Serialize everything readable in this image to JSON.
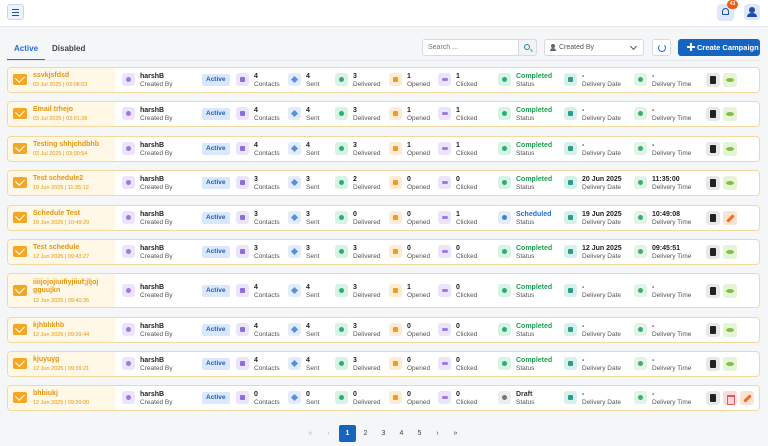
{
  "header": {
    "menu_icon": "menu-icon",
    "notification_icon": "bell-icon",
    "notification_count": "43",
    "user_icon": "user-icon"
  },
  "tabs": [
    {
      "label": "Active",
      "active": true
    },
    {
      "label": "Disabled",
      "active": false
    }
  ],
  "toolbar": {
    "search_placeholder": "Search ...",
    "filter_label": "Created By",
    "create_label": "Create Campaign"
  },
  "labels": {
    "created_by": "Created By",
    "contacts": "Contacts",
    "sent": "Sent",
    "delivered": "Delivered",
    "opened": "Opened",
    "clicked": "Clicked",
    "status": "Status",
    "delivery_date": "Delivery Date",
    "delivery_time": "Delivery Time"
  },
  "campaigns": [
    {
      "name": "ssvkjsfdsd",
      "date": "03 Jul 2025",
      "time": "03:08:03",
      "creator": "harshB",
      "state": "Active",
      "contacts": "4",
      "sent": "4",
      "delivered": "3",
      "opened": "1",
      "clicked": "1",
      "status": "Completed",
      "status_kind": "completed",
      "delivery_date": "-",
      "delivery_time": "-",
      "actions": [
        "copy",
        "view"
      ]
    },
    {
      "name": "Email trhejo",
      "date": "03 Jul 2025",
      "time": "03:01:28",
      "creator": "harshB",
      "state": "Active",
      "contacts": "4",
      "sent": "4",
      "delivered": "3",
      "opened": "1",
      "clicked": "1",
      "status": "Completed",
      "status_kind": "completed",
      "delivery_date": "-",
      "delivery_time": "-",
      "actions": [
        "copy",
        "view"
      ]
    },
    {
      "name": "Testing shhjchdbhb",
      "date": "03 Jul 2025",
      "time": "03:00:54",
      "creator": "harshB",
      "state": "Active",
      "contacts": "4",
      "sent": "4",
      "delivered": "3",
      "opened": "1",
      "clicked": "1",
      "status": "Completed",
      "status_kind": "completed",
      "delivery_date": "-",
      "delivery_time": "-",
      "actions": [
        "copy",
        "view"
      ]
    },
    {
      "name": "Test schedule2",
      "date": "19 Jun 2025",
      "time": "11:35:12",
      "creator": "harshB",
      "state": "Active",
      "contacts": "3",
      "sent": "3",
      "delivered": "2",
      "opened": "0",
      "clicked": "0",
      "status": "Completed",
      "status_kind": "completed",
      "delivery_date": "20 Jun 2025",
      "delivery_time": "11:35:00",
      "actions": [
        "copy",
        "view"
      ]
    },
    {
      "name": "Schedule Test",
      "date": "19 Jun 2025",
      "time": "10:49:29",
      "creator": "harshB",
      "state": "Active",
      "contacts": "3",
      "sent": "3",
      "delivered": "0",
      "opened": "0",
      "clicked": "1",
      "status": "Scheduled",
      "status_kind": "scheduled",
      "delivery_date": "19 Jun 2025",
      "delivery_time": "10:49:08",
      "actions": [
        "copy",
        "edit"
      ]
    },
    {
      "name": "Test schedule",
      "date": "12 Jun 2025",
      "time": "09:43:27",
      "creator": "harshB",
      "state": "Active",
      "contacts": "3",
      "sent": "3",
      "delivered": "3",
      "opened": "0",
      "clicked": "0",
      "status": "Completed",
      "status_kind": "completed",
      "delivery_date": "12 Jun 2025",
      "delivery_time": "09:45:51",
      "actions": [
        "copy",
        "view"
      ]
    },
    {
      "name": "iiiijojojiuifiyjiiuf;jljoj gguujkn",
      "date": "12 Jun 2025",
      "time": "09:40:35",
      "creator": "harshB",
      "state": "Active",
      "contacts": "4",
      "sent": "4",
      "delivered": "3",
      "opened": "1",
      "clicked": "0",
      "status": "Completed",
      "status_kind": "completed",
      "delivery_date": "-",
      "delivery_time": "-",
      "actions": [
        "copy",
        "view"
      ]
    },
    {
      "name": "kjhbhkhb",
      "date": "12 Jun 2025",
      "time": "09:39:44",
      "creator": "harshB",
      "state": "Active",
      "contacts": "4",
      "sent": "4",
      "delivered": "3",
      "opened": "0",
      "clicked": "0",
      "status": "Completed",
      "status_kind": "completed",
      "delivery_date": "-",
      "delivery_time": "-",
      "actions": [
        "copy",
        "view"
      ]
    },
    {
      "name": "kjuyuyg",
      "date": "12 Jun 2025",
      "time": "09:39:21",
      "creator": "harshB",
      "state": "Active",
      "contacts": "4",
      "sent": "4",
      "delivered": "3",
      "opened": "0",
      "clicked": "0",
      "status": "Completed",
      "status_kind": "completed",
      "delivery_date": "-",
      "delivery_time": "-",
      "actions": [
        "copy",
        "view"
      ]
    },
    {
      "name": "bhbiukj",
      "date": "12 Jun 2025",
      "time": "09:39:00",
      "creator": "harshB",
      "state": "Active",
      "contacts": "0",
      "sent": "0",
      "delivered": "0",
      "opened": "0",
      "clicked": "0",
      "status": "Draft",
      "status_kind": "draft",
      "delivery_date": "-",
      "delivery_time": "-",
      "actions": [
        "copy",
        "delete",
        "edit"
      ]
    }
  ],
  "pagination": {
    "first": "«",
    "prev": "‹",
    "pages": [
      "1",
      "2",
      "3",
      "4",
      "5"
    ],
    "current": "1",
    "next": "›",
    "last": "»"
  }
}
